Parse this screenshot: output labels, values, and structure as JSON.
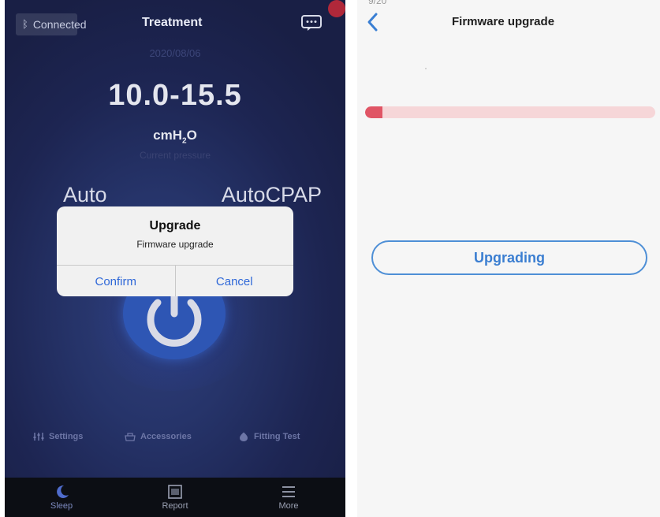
{
  "left": {
    "status": "Connected",
    "title": "Treatment",
    "date": "2020/08/06",
    "pressure": "10.0-15.5",
    "unit_main": "cmH",
    "unit_sub": "2",
    "unit_end": "O",
    "pressure_label": "Current pressure",
    "mode_left": "Auto",
    "mode_right": "AutoCPAP",
    "dialog": {
      "title": "Upgrade",
      "message": "Firmware upgrade",
      "confirm": "Confirm",
      "cancel": "Cancel"
    },
    "links": {
      "settings": "Settings",
      "accessories": "Accessories",
      "fitting": "Fitting Test"
    },
    "tabs": {
      "sleep": "Sleep",
      "report": "Report",
      "more": "More"
    }
  },
  "right": {
    "time": "9/20",
    "title": "Firmware upgrade",
    "progress_fraction": 0.06,
    "button": "Upgrading"
  },
  "colors": {
    "accent_blue": "#2f68d8",
    "progress_red": "#e05565",
    "progress_track": "#f6d6d8",
    "upgrade_border": "#4e8fd6"
  }
}
